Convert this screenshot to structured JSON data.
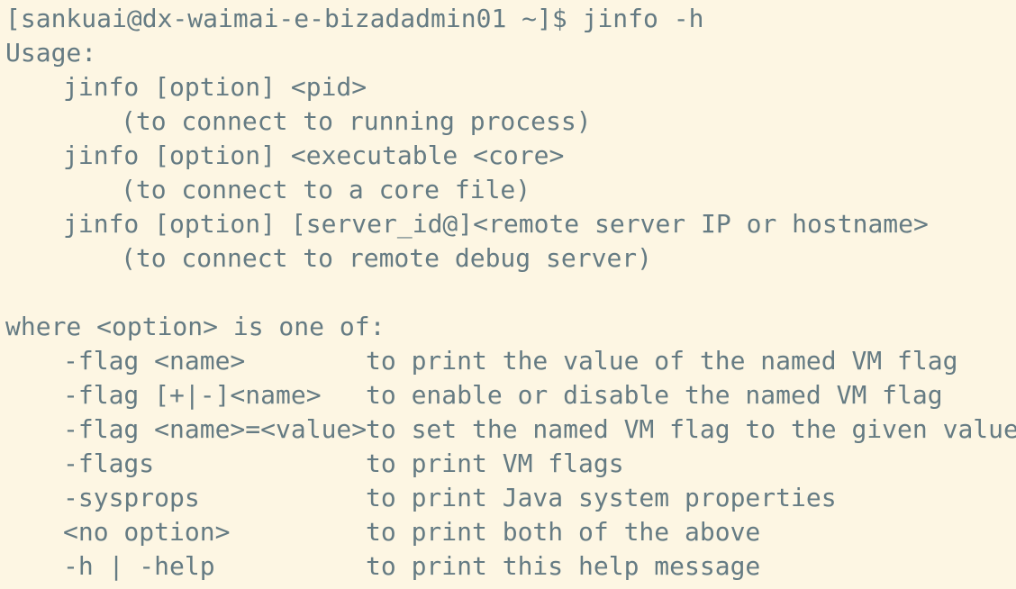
{
  "terminal": {
    "prompt": "[sankuai@dx-waimai-e-bizadadmin01 ~]$ jinfo -h",
    "usage_header": "Usage:",
    "usage": [
      {
        "command": "jinfo [option] <pid>",
        "note": "(to connect to running process)"
      },
      {
        "command": "jinfo [option] <executable <core>",
        "note": "(to connect to a core file)"
      },
      {
        "command": "jinfo [option] [server_id@]<remote server IP or hostname>",
        "note": "(to connect to remote debug server)"
      }
    ],
    "options_header": "where <option> is one of:",
    "options": [
      {
        "name": "-flag <name>",
        "desc": "to print the value of the named VM flag"
      },
      {
        "name": "-flag [+|-]<name>",
        "desc": "to enable or disable the named VM flag"
      },
      {
        "name": "-flag <name>=<value>",
        "desc": "to set the named VM flag to the given value"
      },
      {
        "name": "-flags",
        "desc": "to print VM flags"
      },
      {
        "name": "-sysprops",
        "desc": "to print Java system properties"
      },
      {
        "name": "<no option>",
        "desc": "to print both of the above"
      },
      {
        "name": "-h | -help",
        "desc": "to print this help message"
      }
    ],
    "colors": {
      "background": "#fdf6e3",
      "text": "#657b83"
    }
  }
}
